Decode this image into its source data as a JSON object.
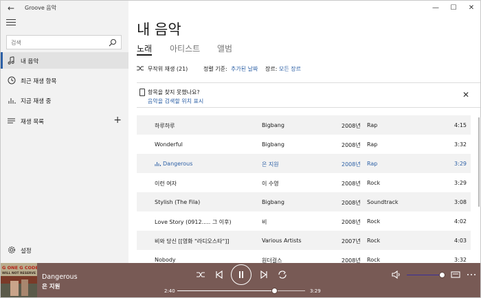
{
  "app": {
    "title": "Groove 음악",
    "back_glyph": "←",
    "minimize_glyph": "—",
    "maximize_glyph": "☐",
    "close_glyph": "✕"
  },
  "sidebar": {
    "search_placeholder": "검색",
    "items": [
      {
        "label": "내 음악",
        "icon": "music-note-icon",
        "active": true
      },
      {
        "label": "최근 재생 항목",
        "icon": "clock-icon",
        "active": false
      },
      {
        "label": "지금 재생 중",
        "icon": "bars-icon",
        "active": false
      },
      {
        "label": "재생 목록",
        "icon": "list-icon",
        "active": false
      }
    ],
    "add_glyph": "+",
    "settings_label": "설정"
  },
  "main": {
    "title": "내 음악",
    "tabs": [
      {
        "label": "노래",
        "active": true
      },
      {
        "label": "아티스트",
        "active": false
      },
      {
        "label": "앨범",
        "active": false
      }
    ],
    "shuffle_label": "무작위 재생 (21)",
    "sort_label": "정렬 기준:",
    "sort_value": "추가된 날짜",
    "genre_label": "장르:",
    "genre_value": "모든 장르",
    "notice": {
      "question": "항목을 찾지 못했나요?",
      "link": "음악을 검색할 위치 표시",
      "close_glyph": "✕"
    },
    "songs": [
      {
        "title": "하루하루",
        "artist": "Bigbang",
        "year": "2008년",
        "genre": "Rap",
        "duration": "4:15"
      },
      {
        "title": "Wonderful",
        "artist": "Bigbang",
        "year": "2008년",
        "genre": "Rap",
        "duration": "3:32"
      },
      {
        "title": "Dangerous",
        "artist": "은 지원",
        "year": "2008년",
        "genre": "Rap",
        "duration": "3:29",
        "playing": true
      },
      {
        "title": "이런 여자",
        "artist": "이 수영",
        "year": "2008년",
        "genre": "Rock",
        "duration": "3:29"
      },
      {
        "title": "Stylish (The Fila)",
        "artist": "Bigbang",
        "year": "2008년",
        "genre": "Soundtrack",
        "duration": "3:08"
      },
      {
        "title": "Love Story (0912..... 그 이후)",
        "artist": "비",
        "year": "2008년",
        "genre": "Rock",
        "duration": "4:02"
      },
      {
        "title": "비와 당신 [[영화 \"라디오스타\"]]",
        "artist": "Various Artists",
        "year": "2007년",
        "genre": "Rock",
        "duration": "4:03"
      },
      {
        "title": "Nobody",
        "artist": "원더걸스",
        "year": "2008년",
        "genre": "Rock",
        "duration": "3:32"
      }
    ]
  },
  "player": {
    "album_art_text_1": "G ONE G CODE",
    "album_art_text_2": "WILL NOT RESERVE",
    "title": "Dangerous",
    "artist": "은 지원",
    "elapsed": "2:40",
    "total": "3:29",
    "progress": 0.766,
    "volume": 0.9
  },
  "colors": {
    "accent": "#2b5fa5",
    "player_bg": "#785a55",
    "sidebar_bg": "#f2f2f2"
  }
}
